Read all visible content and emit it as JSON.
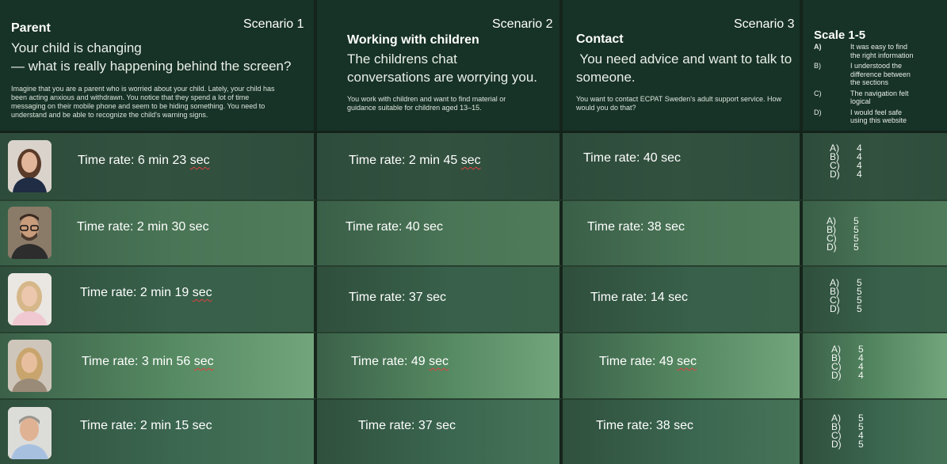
{
  "header": {
    "scenario1": {
      "tag": "Scenario 1",
      "title": "Parent",
      "subtitle_line1": "Your child is changing",
      "subtitle_line2": "— what is really happening behind the screen?",
      "description_lines": [
        "Imagine that you are a parent who is worried about your child. Lately, your child has",
        "been acting anxious and withdrawn. You notice that they spend a lot of time",
        "messaging on their mobile phone and seem to be hiding something. You need to",
        "understand and be able to recognize the child's warning signs."
      ]
    },
    "scenario2": {
      "tag": "Scenario 2",
      "title": "Working with children",
      "subtitle_line1": "The childrens chat",
      "subtitle_line2": "conversations are worrying you.",
      "description_lines": [
        "You work with children and want to find material or",
        "guidance suitable for children aged 13–15."
      ]
    },
    "scenario3": {
      "tag": "Scenario 3",
      "title": "Contact",
      "subtitle_line1": " You need advice and want to talk to",
      "subtitle_line2": "someone.",
      "description_lines": [
        "You want to contact ECPAT Sweden's adult support service. How",
        "would you do that?"
      ]
    },
    "scale": {
      "title": "Scale 1-5",
      "items": [
        {
          "key": "A)",
          "line1": "It was easy to find",
          "line2": "the right information"
        },
        {
          "key": "B)",
          "line1": "I understood the",
          "line2": "difference between",
          "line3": "the sections"
        },
        {
          "key": "C)",
          "line1": "The navigation felt",
          "line2": "logical"
        },
        {
          "key": "D)",
          "line1": "I would feel safe",
          "line2": "using this website"
        }
      ]
    }
  },
  "rows": [
    {
      "avatar": "woman-dark-hair-avatar",
      "s1": {
        "text": "Time rate: 6 min 23 ",
        "sq": "sec"
      },
      "s2": {
        "text": "Time rate: 2 min 45 ",
        "sq": "sec"
      },
      "s3": {
        "text": "Time rate: 40 sec",
        "sq": ""
      },
      "ratings": [
        {
          "k": "A)",
          "v": "4"
        },
        {
          "k": "B)",
          "v": "4"
        },
        {
          "k": "C)",
          "v": "4"
        },
        {
          "k": "D)",
          "v": "4"
        }
      ]
    },
    {
      "avatar": "man-glasses-beard-avatar",
      "s1": {
        "text": "Time rate: 2 min 30 sec",
        "sq": ""
      },
      "s2": {
        "text": "Time rate: 40 sec",
        "sq": ""
      },
      "s3": {
        "text": "Time rate: 38 sec",
        "sq": ""
      },
      "ratings": [
        {
          "k": "A)",
          "v": "5"
        },
        {
          "k": "B)",
          "v": "5"
        },
        {
          "k": "C)",
          "v": "5"
        },
        {
          "k": "D)",
          "v": "5"
        }
      ]
    },
    {
      "avatar": "woman-blonde-avatar",
      "s1": {
        "text": "Time rate: 2 min 19 ",
        "sq": "sec"
      },
      "s2": {
        "text": "Time rate: 37 sec",
        "sq": ""
      },
      "s3": {
        "text": "Time rate: 14 sec",
        "sq": ""
      },
      "ratings": [
        {
          "k": "A)",
          "v": "5"
        },
        {
          "k": "B)",
          "v": "5"
        },
        {
          "k": "C)",
          "v": "5"
        },
        {
          "k": "D)",
          "v": "5"
        }
      ]
    },
    {
      "avatar": "woman-blonde-long-hair-avatar",
      "s1": {
        "text": "Time rate: 3 min 56 ",
        "sq": "sec"
      },
      "s2": {
        "text": "Time rate: 49 ",
        "sq": "sec"
      },
      "s3": {
        "text": "Time rate: 49 ",
        "sq": "sec"
      },
      "ratings": [
        {
          "k": "A)",
          "v": "5"
        },
        {
          "k": "B)",
          "v": "4"
        },
        {
          "k": "C)",
          "v": "4"
        },
        {
          "k": "D)",
          "v": "4"
        }
      ]
    },
    {
      "avatar": "man-gray-hair-avatar",
      "s1": {
        "text": "Time rate: 2 min 15 sec",
        "sq": ""
      },
      "s2": {
        "text": "Time rate: 37 sec",
        "sq": ""
      },
      "s3": {
        "text": "Time rate: 38 sec",
        "sq": ""
      },
      "ratings": [
        {
          "k": "A)",
          "v": "5"
        },
        {
          "k": "B)",
          "v": "5"
        },
        {
          "k": "C)",
          "v": "4"
        },
        {
          "k": "D)",
          "v": "5"
        }
      ]
    }
  ]
}
